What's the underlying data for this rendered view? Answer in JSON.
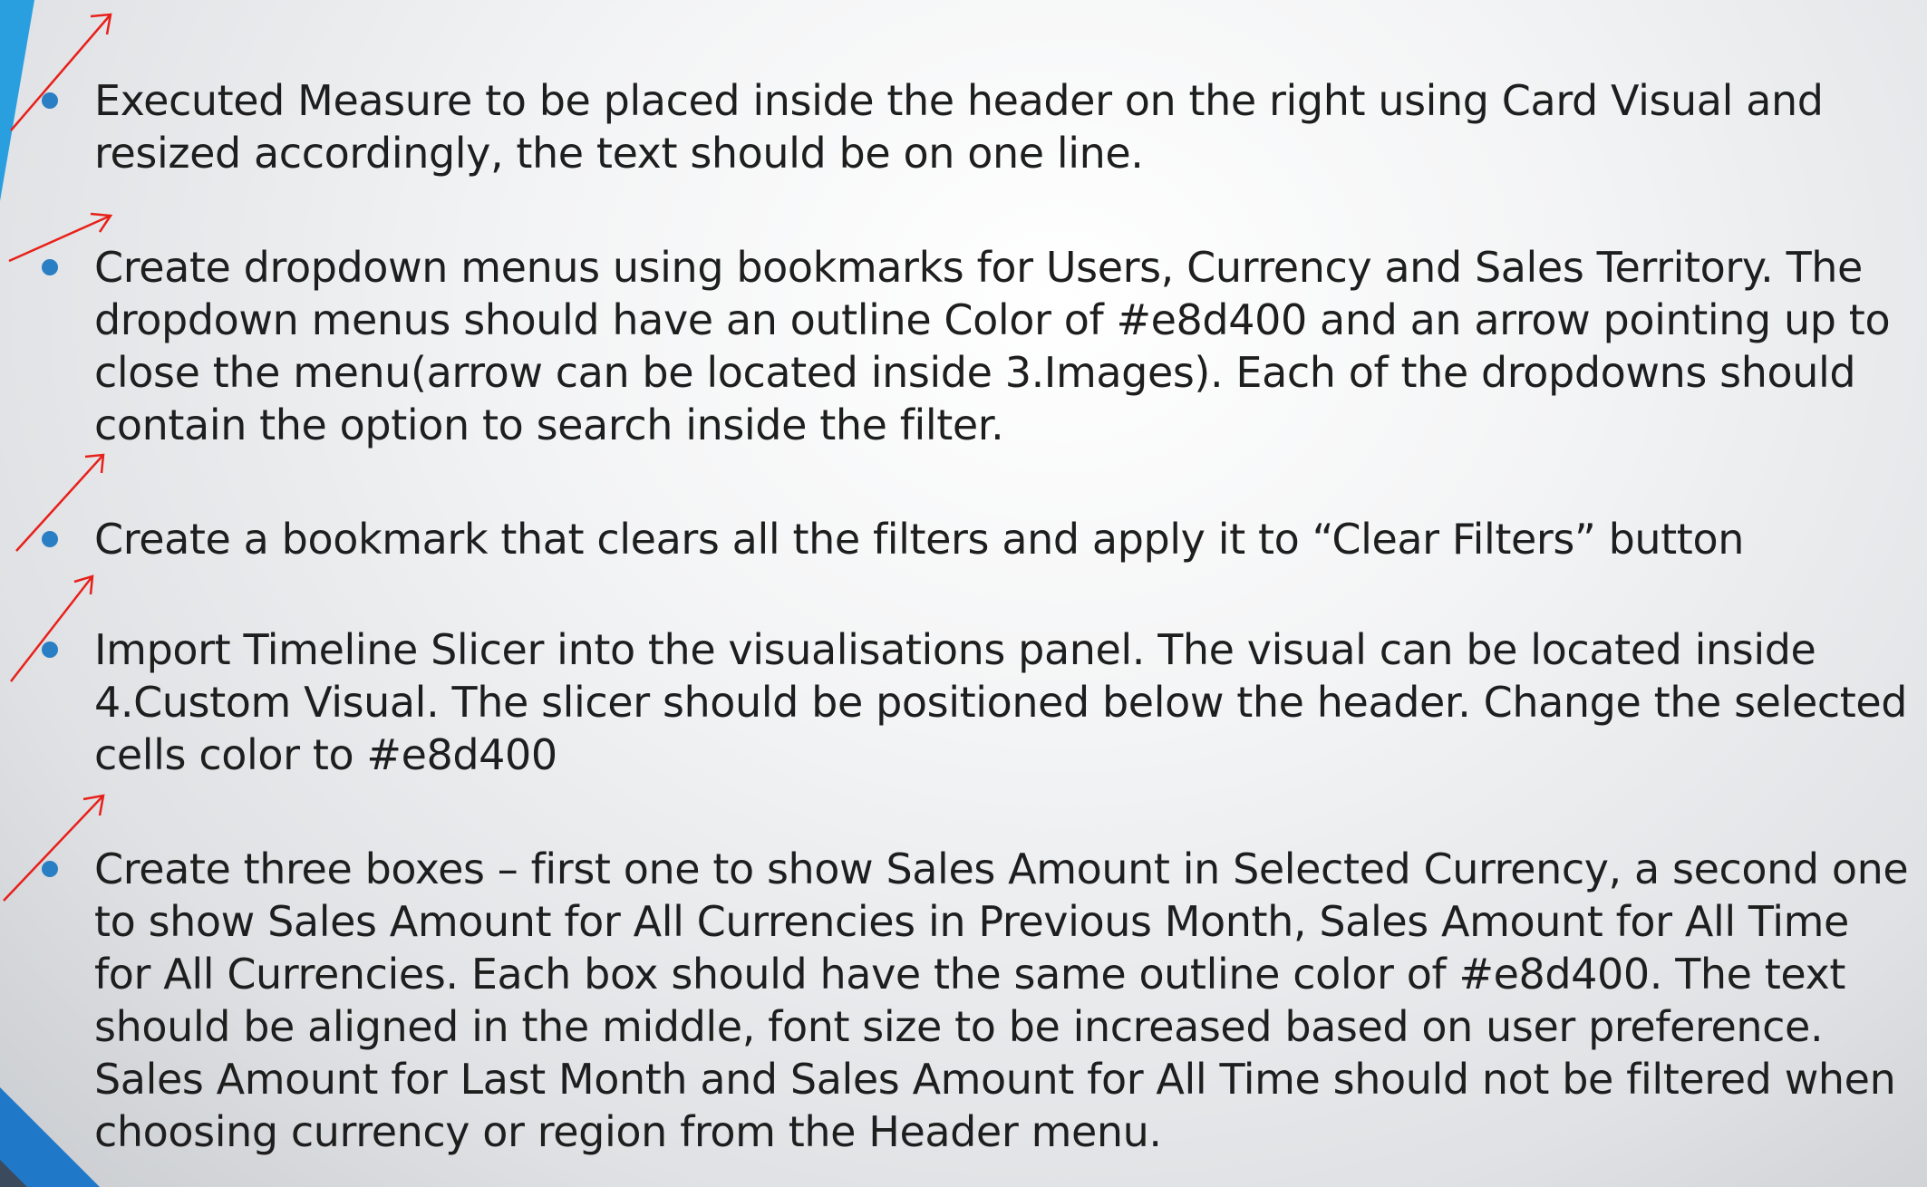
{
  "slide": {
    "accent_color": "#2a9fe0",
    "bullet_color": "#2a7fc4",
    "check_mark_color": "#e8201a",
    "text_color": "#1e1e1e",
    "bullets": [
      {
        "text": "Executed Measure to be placed inside the header on the right using Card Visual and resized accordingly, the text should be on one line."
      },
      {
        "text": "Create dropdown menus using bookmarks for Users, Currency and Sales Territory. The dropdown menus should have an outline Color of #e8d400 and an arrow pointing up to close the menu(arrow can be located inside 3.Images). Each of the dropdowns should contain the option to search inside the filter."
      },
      {
        "text": "Create a bookmark that clears all the filters and apply it to “Clear Filters” button"
      },
      {
        "text": "Import Timeline Slicer into the visualisations panel. The visual can be located inside 4.Custom Visual. The slicer should be positioned below the header. Change the selected cells color to #e8d400"
      },
      {
        "text": "Create three boxes – first one to show Sales Amount in Selected Currency, a second one to show Sales Amount for All Currencies in Previous Month, Sales Amount for All Time for All Currencies. Each box should have the same outline color of #e8d400. The text should be aligned in the middle, font size to be increased based on user preference. Sales Amount for Last Month and Sales Amount for All Time should not be filtered when choosing currency or region from the Header menu."
      }
    ]
  }
}
